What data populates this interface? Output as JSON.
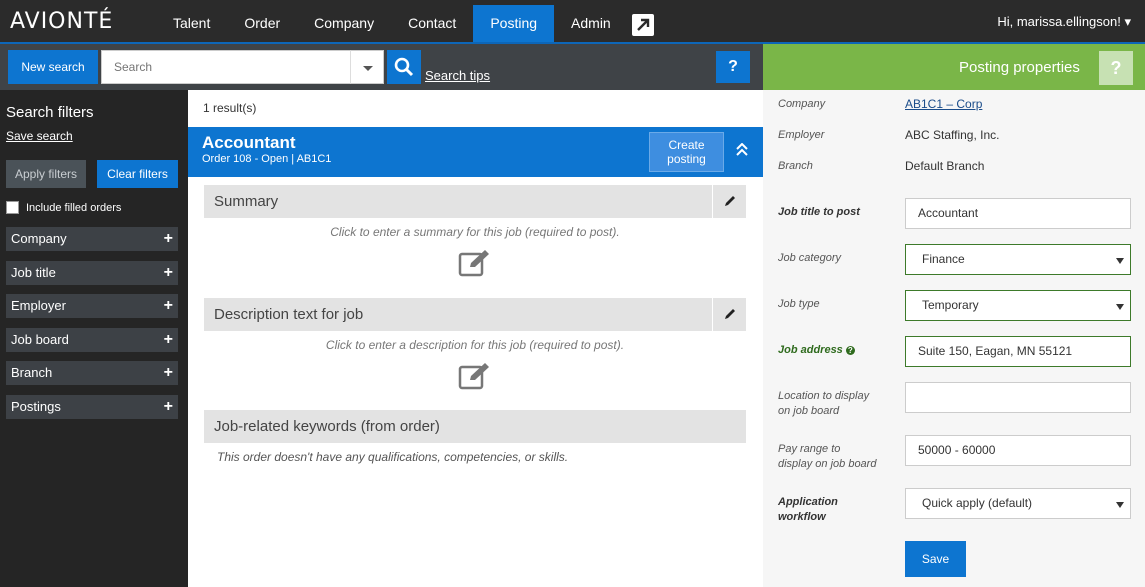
{
  "nav": {
    "logo": "AVIONTÉ",
    "items": [
      {
        "label": "Talent",
        "active": false
      },
      {
        "label": "Order",
        "active": false
      },
      {
        "label": "Company",
        "active": false
      },
      {
        "label": "Contact",
        "active": false
      },
      {
        "label": "Posting",
        "active": true
      },
      {
        "label": "Admin",
        "active": false
      }
    ],
    "external_icon": "external-link-icon",
    "user": "Hi, marissa.ellingson! ▾"
  },
  "search": {
    "new_search_label": "New search",
    "placeholder": "Search",
    "search_tips": "Search tips",
    "help_label": "?"
  },
  "sidebar": {
    "title": "Search filters",
    "save_search": "Save search",
    "apply_filters": "Apply filters",
    "clear_filters": "Clear filters",
    "include_filled": "Include filled orders",
    "filters": [
      "Company",
      "Job title",
      "Employer",
      "Job board",
      "Branch",
      "Postings"
    ],
    "plus": "+"
  },
  "center": {
    "result_count": "1 result(s)",
    "job": {
      "title": "Accountant",
      "subtitle": "Order 108 - Open | AB1C1",
      "create_posting": "Create posting"
    },
    "sections": {
      "summary_label": "Summary",
      "summary_hint": "Click to enter a summary for this job (required to post).",
      "description_label": "Description text for job",
      "description_hint": "Click to enter a description for this job (required to post).",
      "keywords_label": "Job-related keywords (from order)",
      "keywords_hint": "This order doesn't have any qualifications, competencies, or skills."
    }
  },
  "properties": {
    "title": "Posting properties",
    "help_label": "?",
    "company_label": "Company",
    "company_value": "AB1C1 – Corp",
    "employer_label": "Employer",
    "employer_value": "ABC Staffing, Inc.",
    "branch_label": "Branch",
    "branch_value": "Default Branch",
    "job_title_label": "Job title to post",
    "job_title_value": "Accountant",
    "category_label": "Job category",
    "category_value": "Finance",
    "type_label": "Job type",
    "type_value": "Temporary",
    "address_label": "Job address",
    "address_help": "?",
    "address_value": "Suite 150, Eagan, MN 55121",
    "location_label_1": "Location to display",
    "location_label_2": "on job board",
    "location_value": "",
    "pay_label_1": "Pay range to",
    "pay_label_2": "display on job board",
    "pay_value": "50000 - 60000",
    "workflow_label_1": "Application",
    "workflow_label_2": "workflow",
    "workflow_value": "Quick apply (default)",
    "save_label": "Save"
  }
}
